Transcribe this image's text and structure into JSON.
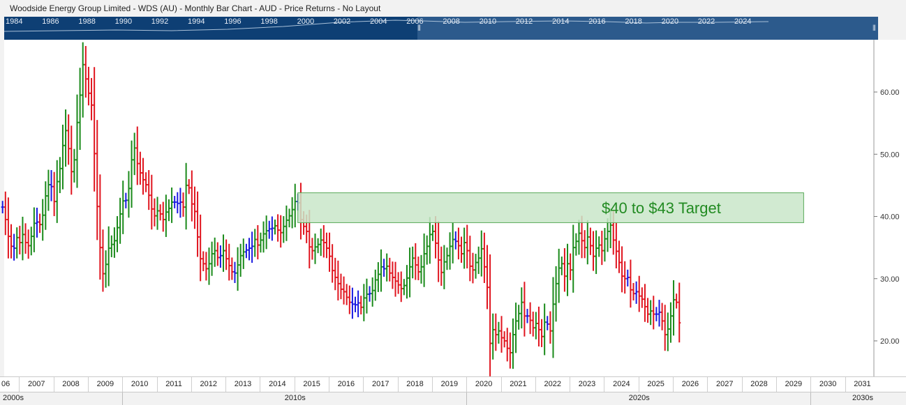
{
  "window": {
    "title": "Woodside Energy Group Limited - WDS (AU) - Monthly Bar Chart - AUD - Price Returns - No Layout"
  },
  "navigator": {
    "years": [
      "1984",
      "1986",
      "1988",
      "1990",
      "1992",
      "1994",
      "1996",
      "1998",
      "2000",
      "2002",
      "2004",
      "2006",
      "2008",
      "2010",
      "2012",
      "2014",
      "2016",
      "2018",
      "2020",
      "2022",
      "2024"
    ],
    "handle_glyph": "|||"
  },
  "colors": {
    "up": "#1a8a1a",
    "down": "#e0141e",
    "neutral": "#1a1ae0",
    "target_fill": "#c9e6c9",
    "target_border": "#5aaa5a",
    "target_text": "#228b22",
    "navigator_bg": "#0e3f74"
  },
  "chart_data": {
    "type": "bar",
    "title": "Woodside Energy Group Limited - WDS (AU) - Monthly Bar Chart - AUD - Price Returns - No Layout",
    "ylim": [
      14,
      69
    ],
    "y_ticks": [
      20,
      30,
      40,
      50,
      60
    ],
    "y_tick_labels": [
      "20.00",
      "30.00",
      "40.00",
      "50.00",
      "60.00"
    ],
    "x_tick_labels": [
      "06",
      "2007",
      "2008",
      "2009",
      "2010",
      "2011",
      "2012",
      "2013",
      "2014",
      "2015",
      "2016",
      "2017",
      "2018",
      "2019",
      "2020",
      "2021",
      "2022",
      "2023",
      "2024",
      "2025",
      "2026",
      "2027",
      "2028",
      "2029",
      "2030",
      "2031"
    ],
    "decades": [
      "2000s",
      "2010s",
      "2020s",
      "2030s"
    ],
    "grid": false,
    "annotation": {
      "text": "$40 to $43 Target",
      "low": 39,
      "high": 43.8,
      "from_year": 2014.6,
      "to_year": 2029.3
    },
    "series": [
      {
        "start": 2006.0,
        "closes": [
          41.5,
          39.5,
          36.8,
          35.2,
          34.9,
          36.6,
          35.8,
          37.1,
          35.8,
          35.3,
          36.8,
          38.9,
          39.1,
          38.7,
          40.2,
          43.3,
          45.1,
          44.8,
          42.4,
          45.6,
          47.7,
          51.4,
          53.8,
          50.9
        ]
      },
      {
        "start": 2008.0,
        "closes": [
          47.2,
          49.1,
          55.1,
          59.5,
          64.4,
          62.1,
          59.8,
          57.9,
          50.1,
          41.6,
          35.0,
          30.8
        ]
      },
      {
        "start": 2009.0,
        "closes": [
          32.3,
          34.9,
          35.5,
          36.1,
          38.2,
          40.4,
          42.5,
          42.6,
          44.5,
          49.1,
          51.0,
          48.5
        ]
      },
      {
        "start": 2010.0,
        "closes": [
          47.0,
          45.9,
          45.1,
          43.4,
          41.2,
          40.1,
          40.9,
          40.4,
          39.5,
          40.7,
          41.3,
          42.3
        ]
      },
      {
        "start": 2011.0,
        "closes": [
          42.3,
          42.1,
          42.3,
          41.5,
          45.0,
          44.6,
          42.0,
          40.8,
          36.7,
          33.2,
          32.4,
          31.6
        ]
      },
      {
        "start": 2012.0,
        "closes": [
          32.4,
          34.0,
          34.5,
          33.4,
          33.7,
          34.5,
          33.2,
          32.1,
          31.1,
          30.9,
          32.2,
          33.7
        ]
      },
      {
        "start": 2013.0,
        "closes": [
          34.3,
          34.6,
          34.9,
          35.2,
          36.3,
          35.4,
          36.2,
          37.2,
          37.7,
          38.0,
          38.1,
          38.5
        ]
      },
      {
        "start": 2014.0,
        "closes": [
          37.8,
          37.4,
          38.4,
          39.4,
          40.1,
          41.1,
          42.4,
          42.2,
          39.5,
          38.4,
          37.6,
          35.1
        ]
      },
      {
        "start": 2015.0,
        "closes": [
          34.5,
          35.1,
          35.5,
          36.2,
          35.8,
          34.9,
          33.6,
          31.3,
          30.2,
          29.2,
          28.3,
          27.9
        ]
      },
      {
        "start": 2016.0,
        "closes": [
          27.0,
          26.2,
          25.9,
          25.8,
          26.1,
          25.4,
          26.9,
          27.5,
          27.6,
          28.1,
          29.8,
          30.7
        ]
      },
      {
        "start": 2017.0,
        "closes": [
          31.9,
          31.6,
          32.0,
          30.9,
          30.2,
          29.6,
          29.0,
          28.4,
          28.9,
          30.1,
          31.9,
          33.3
        ]
      },
      {
        "start": 2018.0,
        "closes": [
          32.2,
          31.1,
          31.9,
          34.0,
          35.2,
          37.1,
          37.6,
          35.7,
          33.0,
          31.0,
          32.7,
          33.7
        ]
      },
      {
        "start": 2019.0,
        "closes": [
          35.2,
          36.3,
          36.0,
          35.3,
          34.0,
          35.8,
          34.5,
          32.0,
          31.4,
          32.6,
          33.3,
          34.8
        ]
      },
      {
        "start": 2020.0,
        "closes": [
          31.9,
          28.6,
          19.6,
          21.8,
          21.0,
          21.6,
          20.5,
          20.0,
          18.8,
          18.1,
          21.0,
          23.2
        ]
      },
      {
        "start": 2021.0,
        "closes": [
          24.4,
          26.2,
          24.0,
          24.0,
          23.3,
          22.1,
          22.8,
          21.8,
          20.7,
          23.0,
          22.7,
          21.6
        ]
      },
      {
        "start": 2022.0,
        "closes": [
          25.9,
          29.2,
          31.7,
          32.4,
          30.4,
          32.4,
          31.4,
          35.0,
          36.0,
          37.3,
          36.1,
          35.0
        ]
      },
      {
        "start": 2023.0,
        "closes": [
          36.7,
          35.3,
          33.6,
          34.9,
          35.4,
          34.5,
          36.4,
          37.6,
          38.6,
          36.2,
          34.4,
          32.6
        ]
      },
      {
        "start": 2024.0,
        "closes": [
          30.4,
          30.0,
          30.2,
          28.2,
          27.6,
          27.9,
          27.2,
          26.7,
          25.5,
          24.3,
          24.8,
          24.3
        ]
      },
      {
        "start": 2025.0,
        "closes": [
          24.3,
          24.6,
          23.2,
          21.0,
          21.9,
          24.0,
          26.6,
          26.2,
          22.9
        ]
      }
    ]
  }
}
